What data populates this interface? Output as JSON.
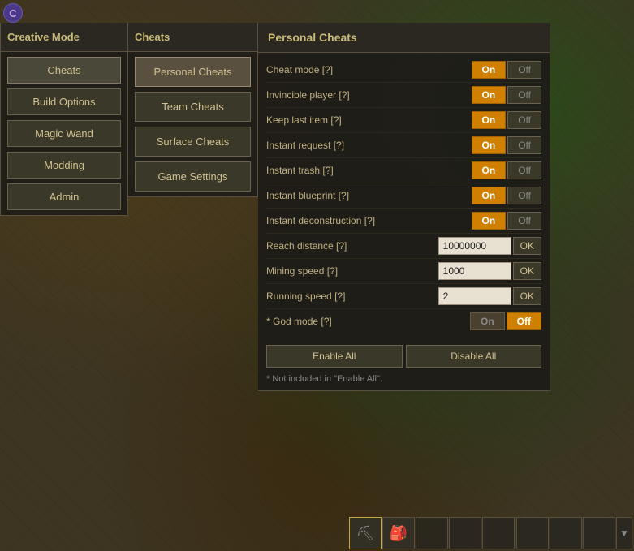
{
  "app": {
    "logo": "C",
    "title": "Creative Mode"
  },
  "left_panel": {
    "title": "Creative Mode",
    "buttons": [
      {
        "label": "Cheats",
        "active": true
      },
      {
        "label": "Build Options",
        "active": false
      },
      {
        "label": "Magic Wand",
        "active": false
      },
      {
        "label": "Modding",
        "active": false
      },
      {
        "label": "Admin",
        "active": false
      }
    ]
  },
  "cheats_panel": {
    "title": "Cheats",
    "buttons": [
      {
        "label": "Personal Cheats",
        "active": true
      },
      {
        "label": "Team Cheats",
        "active": false
      },
      {
        "label": "Surface Cheats",
        "active": false
      },
      {
        "label": "Game Settings",
        "active": false
      }
    ]
  },
  "personal_cheats": {
    "title": "Personal Cheats",
    "options": [
      {
        "label": "Cheat mode [?]",
        "type": "toggle",
        "value": "on"
      },
      {
        "label": "Invincible player [?]",
        "type": "toggle",
        "value": "on"
      },
      {
        "label": "Keep last item [?]",
        "type": "toggle",
        "value": "on"
      },
      {
        "label": "Instant request [?]",
        "type": "toggle",
        "value": "on"
      },
      {
        "label": "Instant trash [?]",
        "type": "toggle",
        "value": "on"
      },
      {
        "label": "Instant blueprint [?]",
        "type": "toggle",
        "value": "on"
      },
      {
        "label": "Instant deconstruction [?]",
        "type": "toggle",
        "value": "on"
      },
      {
        "label": "Reach distance [?]",
        "type": "input",
        "input_value": "10000000"
      },
      {
        "label": "Mining speed [?]",
        "type": "input",
        "input_value": "1000"
      },
      {
        "label": "Running speed [?]",
        "type": "input",
        "input_value": "2"
      },
      {
        "label": "* God mode [?]",
        "type": "toggle_god",
        "value": "off"
      }
    ],
    "enable_all": "Enable All",
    "disable_all": "Disable All",
    "footnote": "* Not included in \"Enable All\".",
    "on_label": "On",
    "off_label": "Off",
    "ok_label": "OK"
  },
  "hotbar": {
    "slots": [
      "⛏",
      "🎒",
      "",
      "",
      "",
      ""
    ],
    "scroll_up": "▲",
    "scroll_down": "▼"
  }
}
